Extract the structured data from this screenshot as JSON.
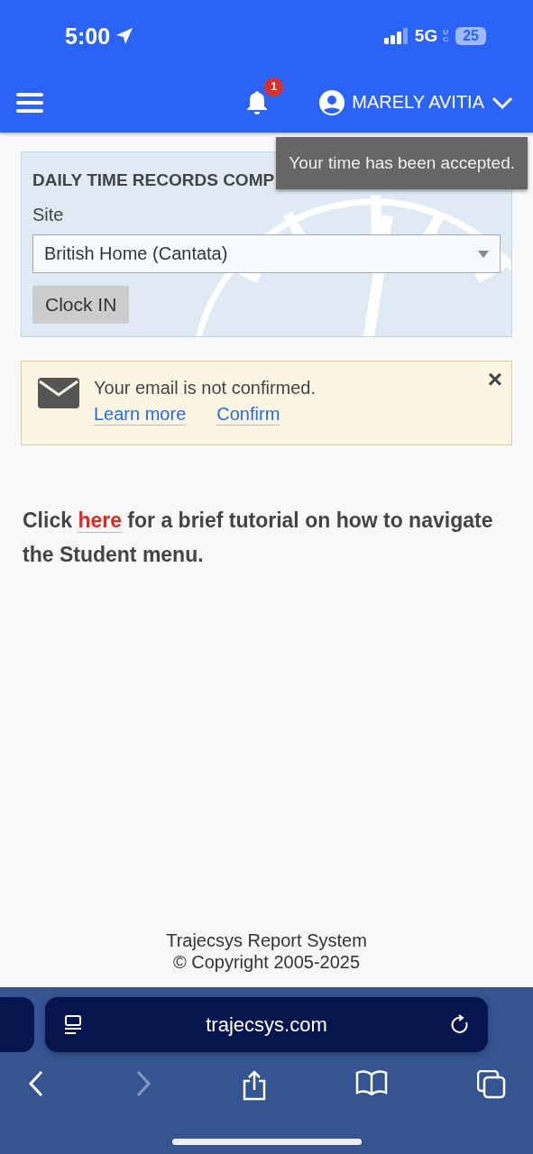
{
  "status_bar": {
    "time": "5:00",
    "network": "5G",
    "network_sub": "UC",
    "battery": "25"
  },
  "header": {
    "notification_count": "1",
    "user_name": "MARELY AVITIA"
  },
  "toast": {
    "message": "Your time has been accepted."
  },
  "time_card": {
    "title": "DAILY TIME RECORDS COMP",
    "site_label": "Site",
    "site_value": "British Home (Cantata)",
    "button": "Clock IN"
  },
  "alert": {
    "message": "Your email is not confirmed.",
    "links": [
      "Learn more",
      "Confirm"
    ],
    "close": "×"
  },
  "tutorial": {
    "before": "Click",
    "link": "here",
    "after": "for a brief tutorial on how to navigate the Student menu."
  },
  "footer": {
    "lines": [
      "Trajecsys Report System",
      "© Copyright 2005-2025"
    ]
  },
  "browser": {
    "url": "trajecsys.com",
    "forward_disabled": true
  }
}
